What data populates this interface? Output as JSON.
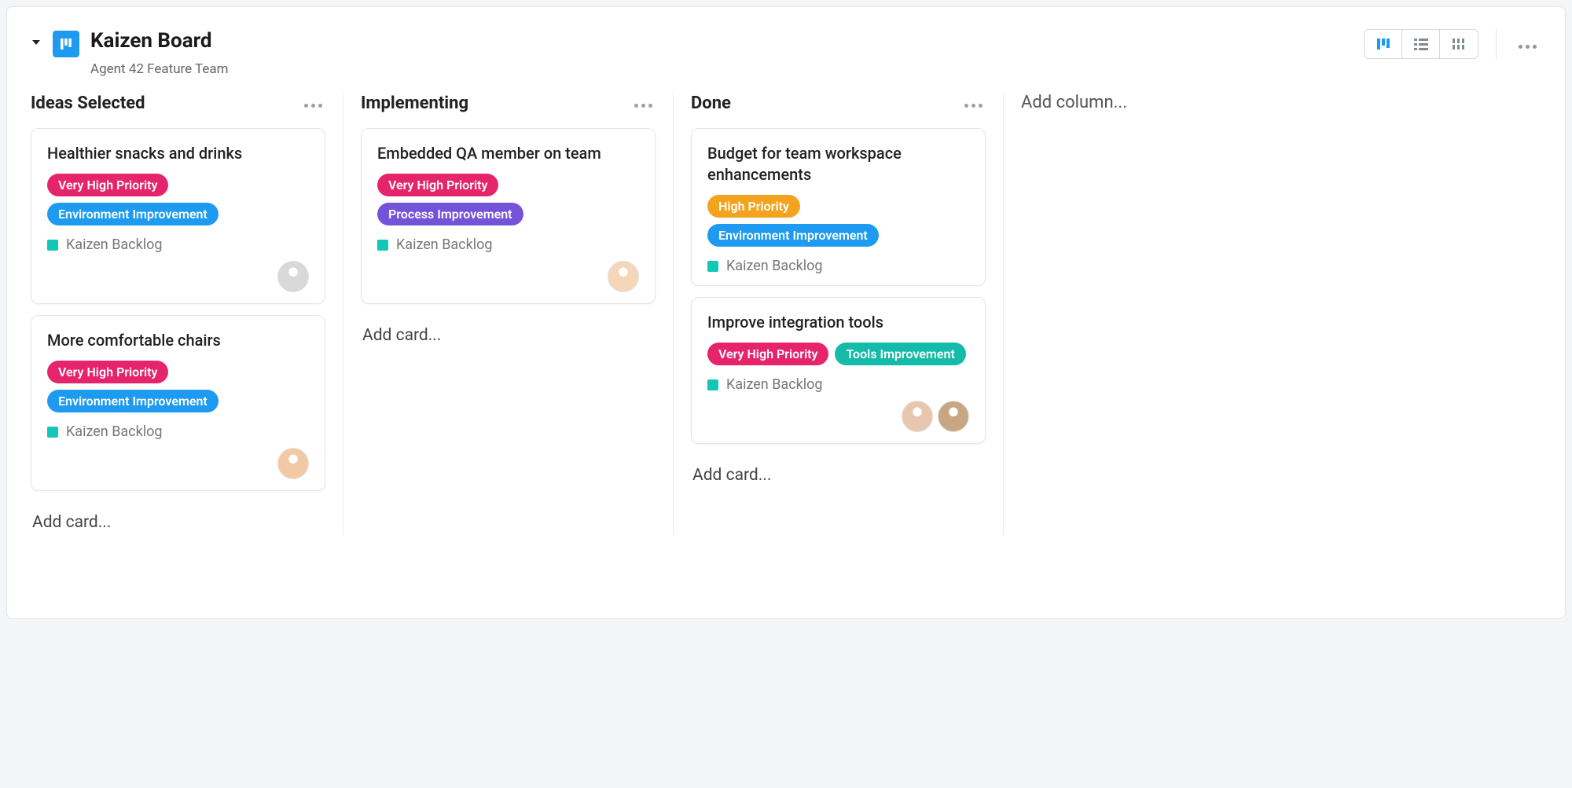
{
  "header": {
    "title": "Kaizen Board",
    "subtitle": "Agent 42 Feature Team"
  },
  "addColumnLabel": "Add column...",
  "addCardLabel": "Add card...",
  "tagColors": {
    "very_high": "#E6246B",
    "high": "#F4A31E",
    "env": "#1E9BF0",
    "process": "#7553D9",
    "tools": "#14BBA8"
  },
  "avatarColors": [
    "#d8d8d8",
    "#f2c9a4",
    "#f4d7b8",
    "#e9c7ae",
    "#c8a683"
  ],
  "columns": [
    {
      "title": "Ideas Selected",
      "cards": [
        {
          "title": "Healthier snacks and drinks",
          "tags": [
            {
              "label": "Very High Priority",
              "colorKey": "very_high"
            },
            {
              "label": "Environment Improvement",
              "colorKey": "env"
            }
          ],
          "source": "Kaizen Backlog",
          "assignees": 1
        },
        {
          "title": "More comfortable chairs",
          "tags": [
            {
              "label": "Very High Priority",
              "colorKey": "very_high"
            },
            {
              "label": "Environment Improvement",
              "colorKey": "env"
            }
          ],
          "source": "Kaizen Backlog",
          "assignees": 1
        }
      ]
    },
    {
      "title": "Implementing",
      "cards": [
        {
          "title": "Embedded QA member on team",
          "tags": [
            {
              "label": "Very High Priority",
              "colorKey": "very_high"
            },
            {
              "label": "Process Improvement",
              "colorKey": "process"
            }
          ],
          "source": "Kaizen Backlog",
          "assignees": 1
        }
      ]
    },
    {
      "title": "Done",
      "cards": [
        {
          "title": "Budget for team workspace enhancements",
          "tags": [
            {
              "label": "High Priority",
              "colorKey": "high"
            },
            {
              "label": "Environment Improvement",
              "colorKey": "env"
            }
          ],
          "source": "Kaizen Backlog",
          "assignees": 0
        },
        {
          "title": "Improve integration tools",
          "tags": [
            {
              "label": "Very High Priority",
              "colorKey": "very_high"
            },
            {
              "label": "Tools Improvement",
              "colorKey": "tools"
            }
          ],
          "source": "Kaizen Backlog",
          "assignees": 2
        }
      ]
    }
  ]
}
